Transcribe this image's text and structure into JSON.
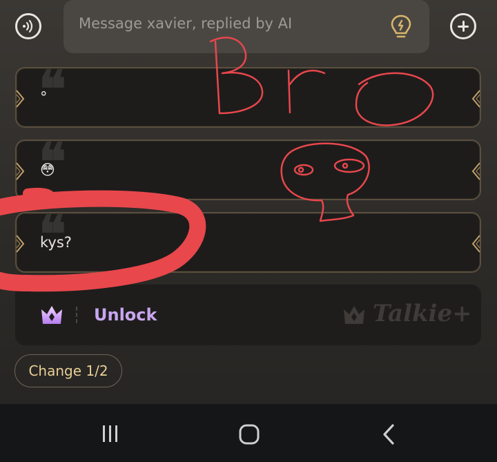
{
  "composer": {
    "voice_icon": "voice-wave-icon",
    "placeholder": "Message xavier, replied by AI",
    "idea_icon": "lightbulb-icon",
    "add_icon": "plus-circle-icon"
  },
  "suggested_replies": [
    {
      "text": "°"
    },
    {
      "text": "😳"
    },
    {
      "text": "kys?"
    }
  ],
  "unlock": {
    "label": "Unlock",
    "icon": "crown-icon",
    "watermark": "Talkie+"
  },
  "change_button": {
    "label": "Change 1/2"
  },
  "nav": {
    "recents_icon": "recents-icon",
    "home_icon": "home-icon",
    "back_icon": "back-icon"
  },
  "colors": {
    "background": "#2e2b28",
    "card": "#1d1c1b",
    "card_border": "#5a4f3e",
    "unlock_accent": "#c9a6f0",
    "change_text": "#e8cf96",
    "annotation_red": "#e8474c"
  }
}
